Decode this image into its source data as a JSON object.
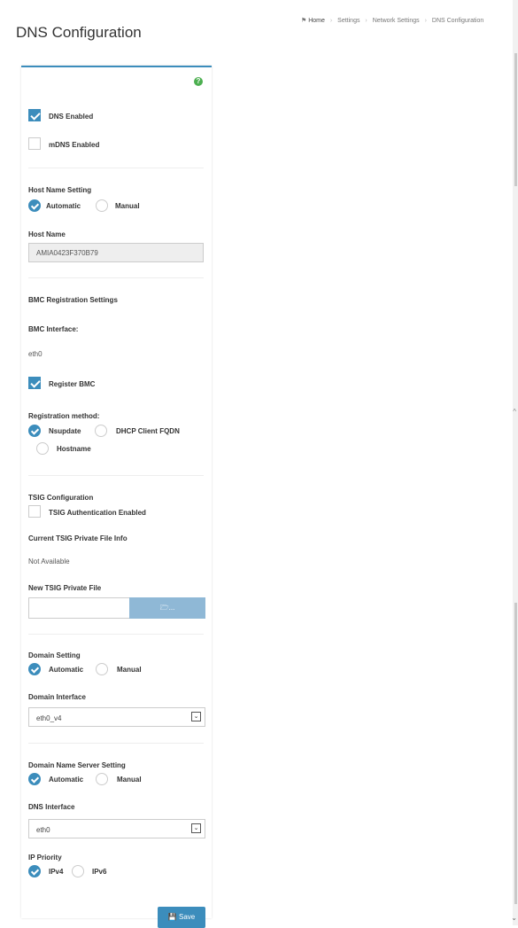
{
  "page": {
    "title": "DNS Configuration"
  },
  "breadcrumb": {
    "home": "Home",
    "settings": "Settings",
    "network_settings": "Network Settings",
    "current": "DNS Configuration"
  },
  "form": {
    "dns_enabled": {
      "label": "DNS Enabled",
      "checked": true
    },
    "mdns_enabled": {
      "label": "mDNS Enabled",
      "checked": false
    },
    "host_name_setting": {
      "label": "Host Name Setting",
      "options": [
        "Automatic",
        "Manual"
      ],
      "selected": "Automatic"
    },
    "host_name": {
      "label": "Host Name",
      "value": "AMIA0423F370B79"
    },
    "bmc_registration": {
      "section_title": "BMC Registration Settings",
      "interface_label": "BMC Interface:",
      "interface_value": "eth0",
      "register_bmc": {
        "label": "Register BMC",
        "checked": true
      },
      "method_label": "Registration method:",
      "methods": [
        "Nsupdate",
        "DHCP Client FQDN",
        "Hostname"
      ],
      "selected_method": "Nsupdate"
    },
    "tsig": {
      "section_title": "TSIG Configuration",
      "auth_enabled": {
        "label": "TSIG Authentication Enabled",
        "checked": false
      },
      "current_file_label": "Current TSIG Private File Info",
      "current_file_value": "Not Available",
      "new_file_label": "New TSIG Private File",
      "new_file_value": "",
      "browse_label": "..."
    },
    "domain_setting": {
      "label": "Domain Setting",
      "options": [
        "Automatic",
        "Manual"
      ],
      "selected": "Automatic",
      "interface_label": "Domain Interface",
      "interface_value": "eth0_v4"
    },
    "dns_server_setting": {
      "label": "Domain Name Server Setting",
      "options": [
        "Automatic",
        "Manual"
      ],
      "selected": "Automatic",
      "interface_label": "DNS Interface",
      "interface_value": "eth0"
    },
    "ip_priority": {
      "label": "IP Priority",
      "options": [
        "IPv4",
        "IPv6"
      ],
      "selected": "IPv4"
    },
    "save_label": "Save"
  },
  "colors": {
    "accent": "#3c8dbc",
    "help": "#4caf50"
  }
}
